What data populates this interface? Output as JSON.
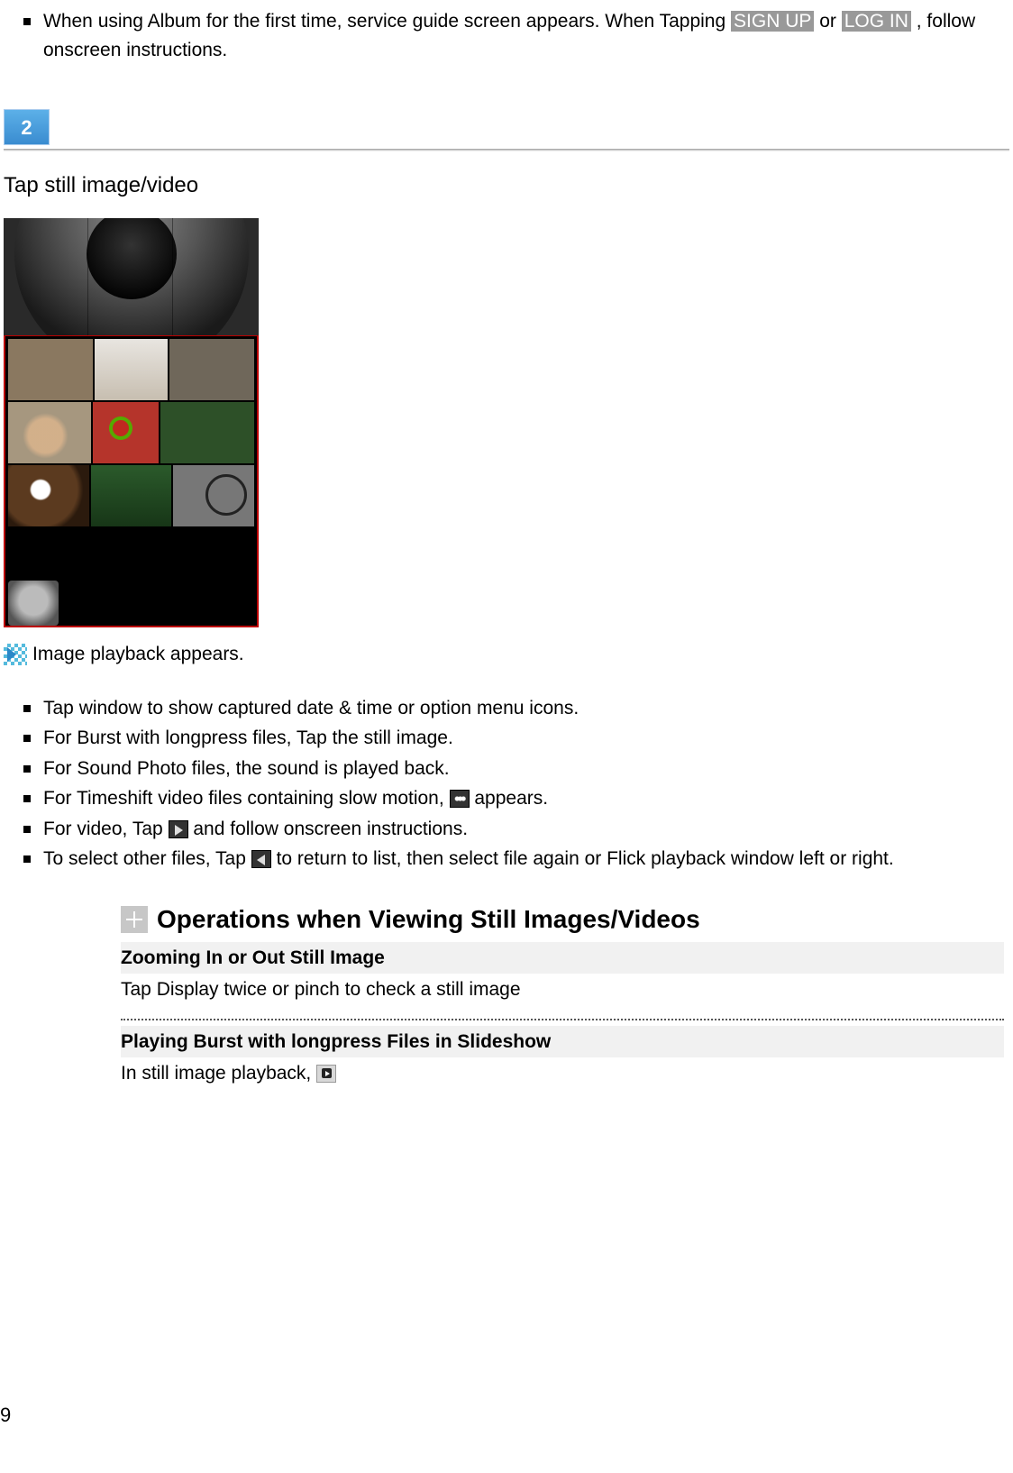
{
  "intro_bullet": {
    "prefix": "When using Album for the first time, service guide screen appears. When Tapping ",
    "signup": "SIGN UP",
    "middle": " or ",
    "login": "LOG IN",
    "suffix": ", follow onscreen instructions."
  },
  "step": {
    "number": "2",
    "title": "Tap still image/video"
  },
  "arrow_text": "Image playback appears.",
  "sub_bullets": {
    "b1": "Tap window to show captured date & time or option menu icons.",
    "b2": "For Burst with longpress files, Tap the still image.",
    "b3": "For Sound Photo files, the sound is played back.",
    "b4_pre": "For Timeshift video files containing slow motion, ",
    "b4_post": " appears.",
    "b5_pre": "For video, Tap ",
    "b5_post": " and follow onscreen instructions.",
    "b6_pre": "To select other files, Tap ",
    "b6_post": " to return to list, then select file again or Flick playback window left or right."
  },
  "ops": {
    "heading": "Operations when Viewing Still Images/Videos",
    "zoom_title": "Zooming In or Out Still Image",
    "zoom_body": "Tap Display twice or pinch to check a still image",
    "burst_title": "Playing Burst with longpress Files in Slideshow",
    "burst_body": "In still image playback, "
  },
  "page_number": "9"
}
